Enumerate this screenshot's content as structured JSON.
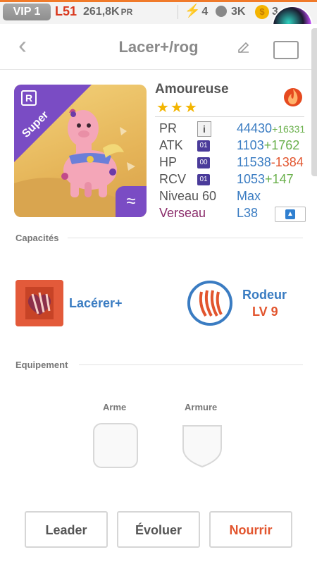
{
  "status": {
    "vip": "VIP 1",
    "level": "L51",
    "pr_value": "261,8K",
    "pr_unit": "PR",
    "energy": "4",
    "paws": "3K",
    "coins": "3"
  },
  "header": {
    "title": "Lacer+/rog"
  },
  "pet": {
    "name": "Amoureuse",
    "rarity_label": "Super",
    "stars": "★★★",
    "stats": {
      "pr_label": "PR",
      "pr_value": "44430",
      "pr_bonus": "+16331",
      "atk_label": "ATK",
      "atk_badge": "01",
      "atk_value": "1103",
      "atk_bonus": "+1762",
      "hp_label": "HP",
      "hp_badge": "00",
      "hp_value": "11538",
      "hp_bonus": "-1384",
      "rcv_label": "RCV",
      "rcv_badge": "01",
      "rcv_value": "1053",
      "rcv_bonus": "+147",
      "niveau_label": "Niveau 60",
      "niveau_value": "Max",
      "sign_label": "Verseau",
      "sign_value": "L38"
    }
  },
  "capacities": {
    "section_label": "Capacités",
    "skill_name": "Lacérer+",
    "leader_name": "Rodeur",
    "leader_level": "LV 9"
  },
  "equipment": {
    "section_label": "Equipement",
    "weapon_label": "Arme",
    "armor_label": "Armure"
  },
  "buttons": {
    "leader": "Leader",
    "evolve": "Évoluer",
    "feed": "Nourrir"
  },
  "colors": {
    "accent_blue": "#3a7cc2",
    "accent_red": "#e2552e",
    "rarity_purple": "#7a4cc4"
  }
}
